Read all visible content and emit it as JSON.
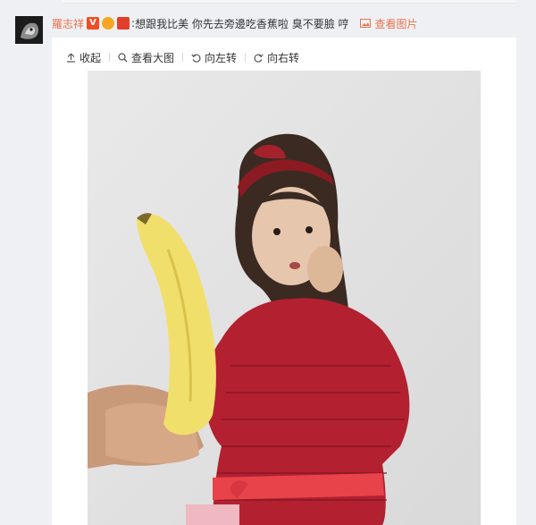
{
  "post": {
    "username": "羅志祥",
    "text": "想跟我比美 你先去旁邊吃香蕉啦 臭不要臉 哼",
    "view_pic": "查看图片"
  },
  "toolbar": {
    "collapse": "收起",
    "view_large": "查看大图",
    "rotate_left": "向左转",
    "rotate_right": "向右转"
  },
  "icons": {
    "verified": "verified-v-icon",
    "crown": "crown-icon",
    "shield": "shield-badge-icon",
    "picture": "picture-icon"
  },
  "colors": {
    "link": "#eb7350",
    "page_bg": "#eef0f3"
  }
}
